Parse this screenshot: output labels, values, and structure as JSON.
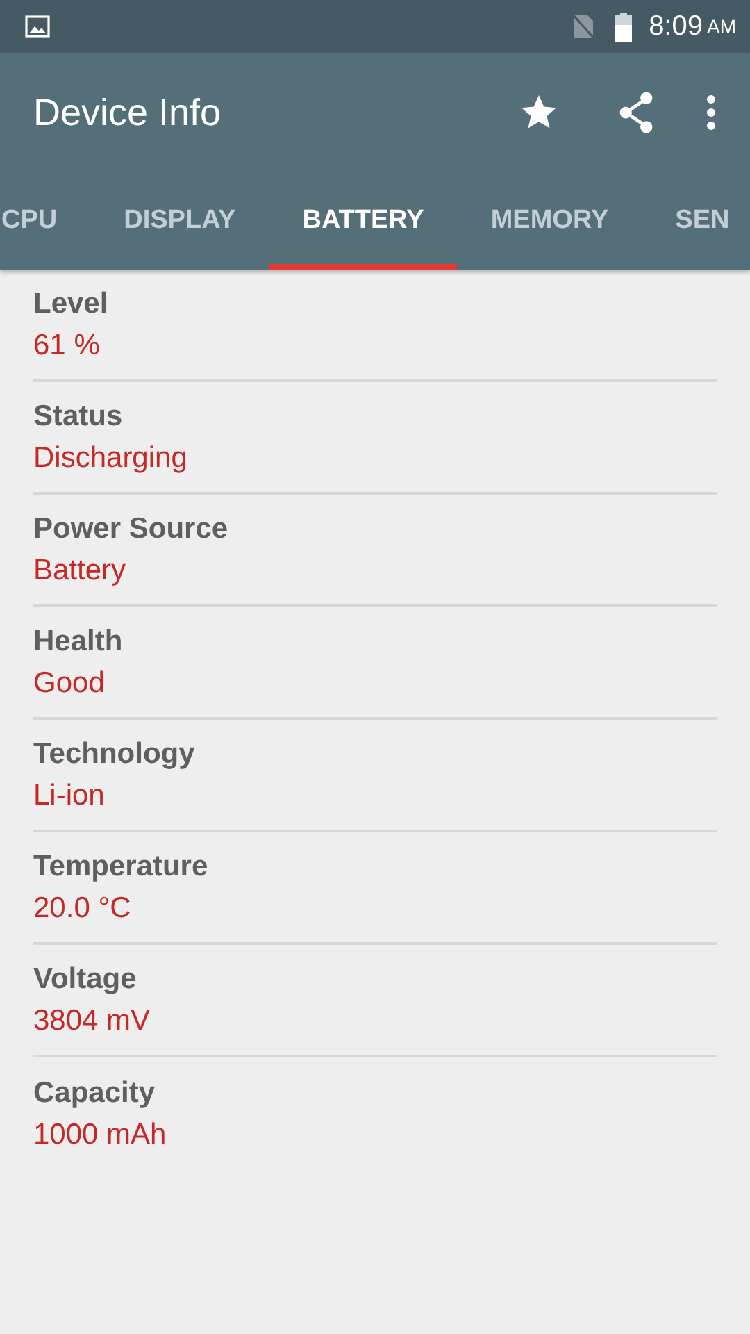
{
  "status_bar": {
    "time": "8:09",
    "period": "AM"
  },
  "app_bar": {
    "title": "Device Info"
  },
  "tabs": [
    {
      "label": "CPU",
      "selected": false
    },
    {
      "label": "DISPLAY",
      "selected": false
    },
    {
      "label": "BATTERY",
      "selected": true
    },
    {
      "label": "MEMORY",
      "selected": false
    },
    {
      "label": "SEN",
      "selected": false
    }
  ],
  "items": [
    {
      "label": "Level",
      "value": "61 %"
    },
    {
      "label": "Status",
      "value": "Discharging"
    },
    {
      "label": "Power Source",
      "value": "Battery"
    },
    {
      "label": "Health",
      "value": "Good"
    },
    {
      "label": "Technology",
      "value": "Li-ion"
    },
    {
      "label": "Temperature",
      "value": "20.0 °C"
    },
    {
      "label": "Voltage",
      "value": "3804 mV"
    },
    {
      "label": "Capacity",
      "value": "1000 mAh"
    }
  ]
}
